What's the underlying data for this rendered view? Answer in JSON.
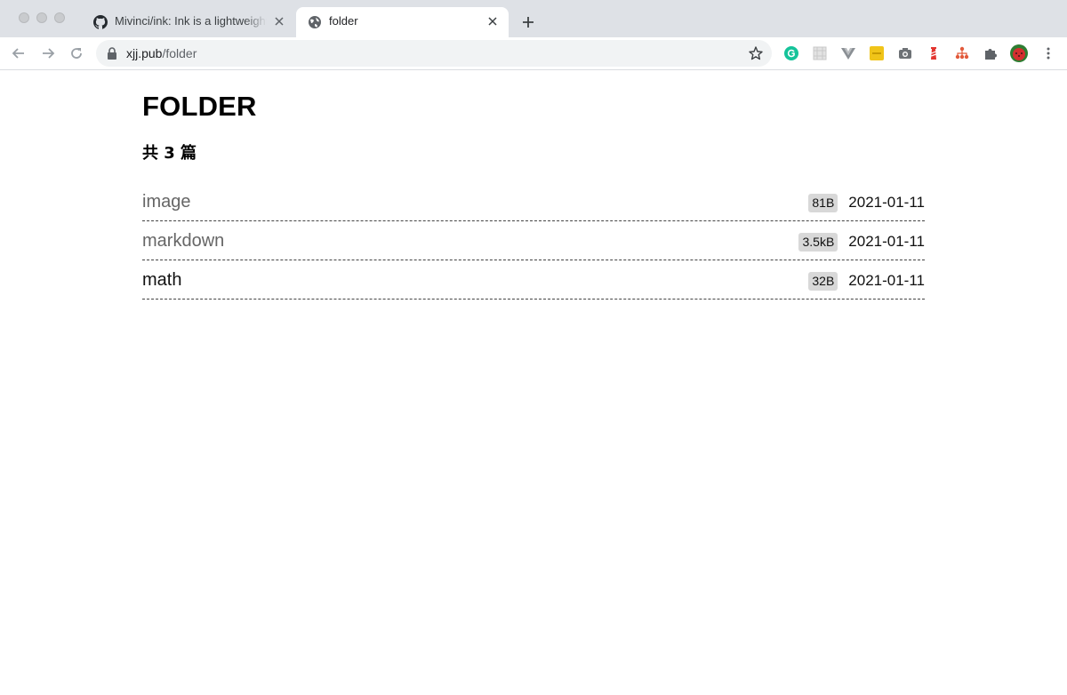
{
  "browser": {
    "tabs": [
      {
        "title": "Mivinci/ink: Ink is a lightweight",
        "icon": "github-icon",
        "active": false
      },
      {
        "title": "folder",
        "icon": "globe-icon",
        "active": true
      }
    ],
    "url": {
      "host": "xjj.pub",
      "path": "/folder"
    }
  },
  "page": {
    "title": "FOLDER",
    "count": "共 3 篇",
    "items": [
      {
        "name": "image",
        "size": "81B",
        "date": "2021-01-11"
      },
      {
        "name": "markdown",
        "size": "3.5kB",
        "date": "2021-01-11"
      },
      {
        "name": "math",
        "size": "32B",
        "date": "2021-01-11"
      }
    ]
  },
  "colors": {
    "tabstrip": "#dee1e6",
    "badge": "#d8d8d8",
    "link_visited": "#666666"
  }
}
